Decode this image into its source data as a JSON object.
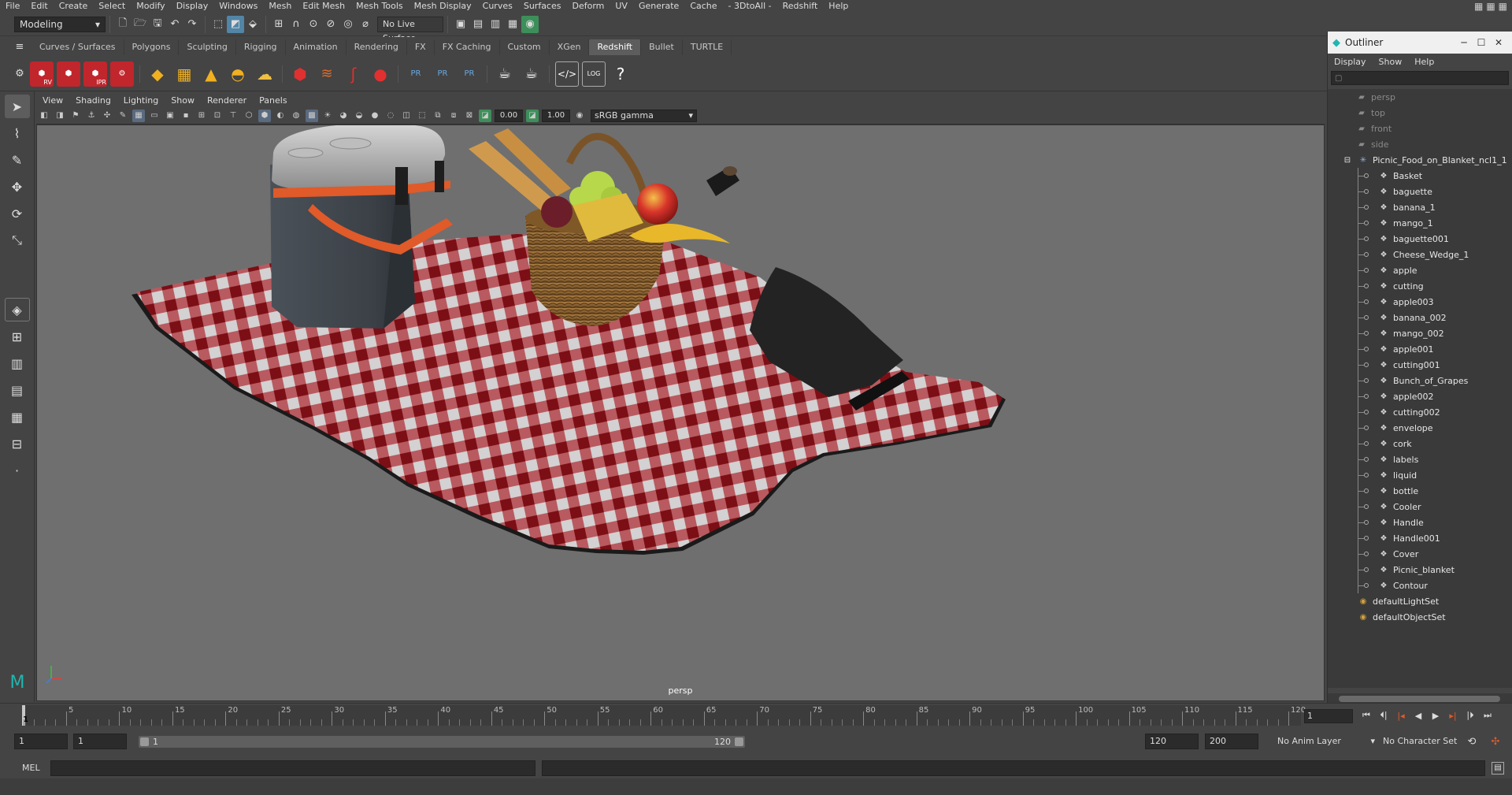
{
  "menubar": {
    "items": [
      "File",
      "Edit",
      "Create",
      "Select",
      "Modify",
      "Display",
      "Windows",
      "Mesh",
      "Edit Mesh",
      "Mesh Tools",
      "Mesh Display",
      "Curves",
      "Surfaces",
      "Deform",
      "UV",
      "Generate",
      "Cache",
      "- 3DtoAll -",
      "Redshift",
      "Help"
    ]
  },
  "statusline": {
    "workspace": "Modeling",
    "live_surface": "No Live Surface"
  },
  "shelf": {
    "tabs": [
      "Curves / Surfaces",
      "Polygons",
      "Sculpting",
      "Rigging",
      "Animation",
      "Rendering",
      "FX",
      "FX Caching",
      "Custom",
      "XGen",
      "Redshift",
      "Bullet",
      "TURTLE"
    ],
    "active_tab": "Redshift",
    "icon_labels": {
      "rv": "RV",
      "ipr": "IPR",
      "pr": "PR",
      "log": "LOG"
    }
  },
  "viewport": {
    "menu": [
      "View",
      "Shading",
      "Lighting",
      "Show",
      "Renderer",
      "Panels"
    ],
    "exposure": "0.00",
    "gamma": "1.00",
    "colorspace": "sRGB gamma",
    "camera_label": "persp"
  },
  "outliner": {
    "title": "Outliner",
    "menu": [
      "Display",
      "Show",
      "Help"
    ],
    "cameras": [
      "persp",
      "top",
      "front",
      "side"
    ],
    "root": "Picnic_Food_on_Blanket_ncl1_1",
    "children": [
      "Basket",
      "baguette",
      "banana_1",
      "mango_1",
      "baguette001",
      "Cheese_Wedge_1",
      "apple",
      "cutting",
      "apple003",
      "banana_002",
      "mango_002",
      "apple001",
      "cutting001",
      "Bunch_of_Grapes",
      "apple002",
      "cutting002",
      "envelope",
      "cork",
      "labels",
      "liquid",
      "bottle",
      "Cooler",
      "Handle",
      "Handle001",
      "Cover",
      "Picnic_blanket",
      "Contour"
    ],
    "sets": [
      "defaultLightSet",
      "defaultObjectSet"
    ]
  },
  "timeline": {
    "tick_labels": [
      "5",
      "10",
      "15",
      "20",
      "25",
      "30",
      "35",
      "40",
      "45",
      "50",
      "55",
      "60",
      "65",
      "70",
      "75",
      "80",
      "85",
      "90",
      "95",
      "100",
      "105",
      "110",
      "115",
      "120"
    ],
    "current_frame_label": "1",
    "current_frame": "1",
    "tick_first": 1,
    "tick_last": 120
  },
  "range": {
    "start_time": "1",
    "playback_start": "1",
    "slider_start": "1",
    "slider_end": "120",
    "playback_end": "120",
    "end_time": "200",
    "anim_layer": "No Anim Layer",
    "character_set": "No Character Set"
  },
  "cmdline": {
    "label": "MEL"
  },
  "colors": {
    "accent": "#5285a6",
    "blanket_red": "#b3232b",
    "cooler_orange": "#e05a2a"
  }
}
